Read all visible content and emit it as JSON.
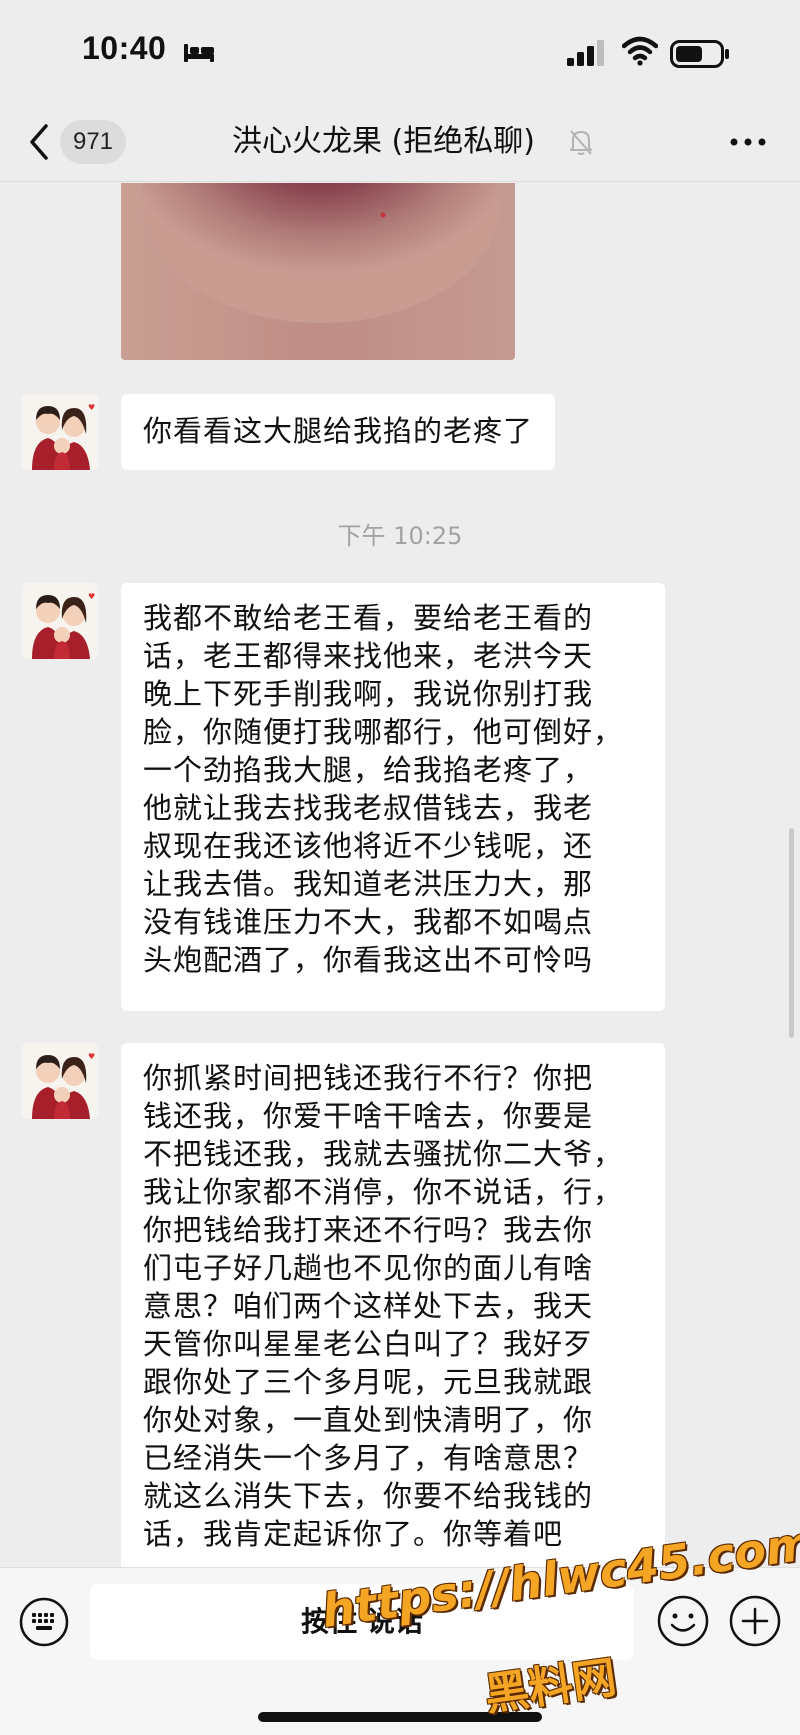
{
  "status_bar": {
    "time": "10:40",
    "icons": [
      "bed-icon",
      "signal-icon",
      "wifi-icon",
      "battery-icon"
    ]
  },
  "nav": {
    "back_icon": "back-chevron-icon",
    "unread_count": "971",
    "title": "洪心火龙果 (拒绝私聊)",
    "mute_icon": "mute-bell-icon",
    "more_icon": "more-icon"
  },
  "messages": [
    {
      "type": "image",
      "description_icon": "photo-thumbnail"
    },
    {
      "type": "text",
      "text": "你看看这大腿给我掐的老疼了"
    },
    {
      "type": "time",
      "text": "下午 10:25"
    },
    {
      "type": "text",
      "text": "我都不敢给老王看，要给老王看的\n话，老王都得来找他来，老洪今天\n晚上下死手削我啊，我说你别打我\n脸，你随便打我哪都行，他可倒好，\n一个劲掐我大腿，给我掐老疼了，\n他就让我去找我老叔借钱去，我老\n叔现在我还该他将近不少钱呢，还\n让我去借。我知道老洪压力大，那\n没有钱谁压力不大，我都不如喝点\n头炮配酒了，你看我这出不可怜吗"
    },
    {
      "type": "text",
      "text": "你抓紧时间把钱还我行不行？你把\n钱还我，你爱干啥干啥去，你要是\n不把钱还我，我就去骚扰你二大爷，\n我让你家都不消停，你不说话，行，\n你把钱给我打来还不行吗？我去你\n们屯子好几趟也不见你的面儿有啥\n意思？咱们两个这样处下去，我天\n天管你叫星星老公白叫了？我好歹\n跟你处了三个多月呢，元旦我就跟\n你处对象，一直处到快清明了，你\n已经消失一个多月了，有啥意思？\n就这么消失下去，你要不给我钱的\n话，我肯定起诉你了。你等着吧"
    }
  ],
  "input_bar": {
    "left_icon": "keyboard-icon",
    "hold_to_talk": "按住 说话",
    "emoji_icon": "emoji-icon",
    "plus_icon": "plus-icon"
  },
  "watermark": {
    "url": "https://hlwc45.com",
    "label": "黑料网"
  },
  "colors": {
    "background": "#ededed",
    "bubble": "#ffffff",
    "watermark": "#f5a524"
  }
}
